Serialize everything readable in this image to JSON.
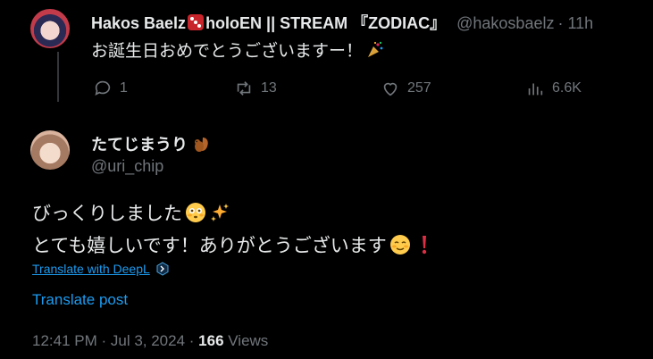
{
  "parent_tweet": {
    "display_name": "Hakos Baelz",
    "display_name_suffix": "holoEN || STREAM 『ZODIAC』",
    "handle": "@hakosbaelz",
    "time": "· 11h",
    "text": "お誕生日おめでとうございますー！",
    "actions": {
      "replies": "1",
      "reposts": "13",
      "likes": "257",
      "views": "6.6K"
    }
  },
  "main_tweet": {
    "display_name": "たてじまうり",
    "handle": "@uri_chip",
    "text_line1": "びっくりしました",
    "text_line2": "とても嬉しいです！ありがとうございます",
    "translate_deepl": "Translate with DeepL",
    "translate_post": "Translate post",
    "timestamp": "12:41 PM · Jul 3, 2024 · ",
    "views_count": "166",
    "views_label": " Views"
  },
  "colors": {
    "background": "#000000",
    "text_primary": "#e7e9ea",
    "text_secondary": "#71767b",
    "link": "#1d9bf0",
    "thread_line": "#333639"
  }
}
